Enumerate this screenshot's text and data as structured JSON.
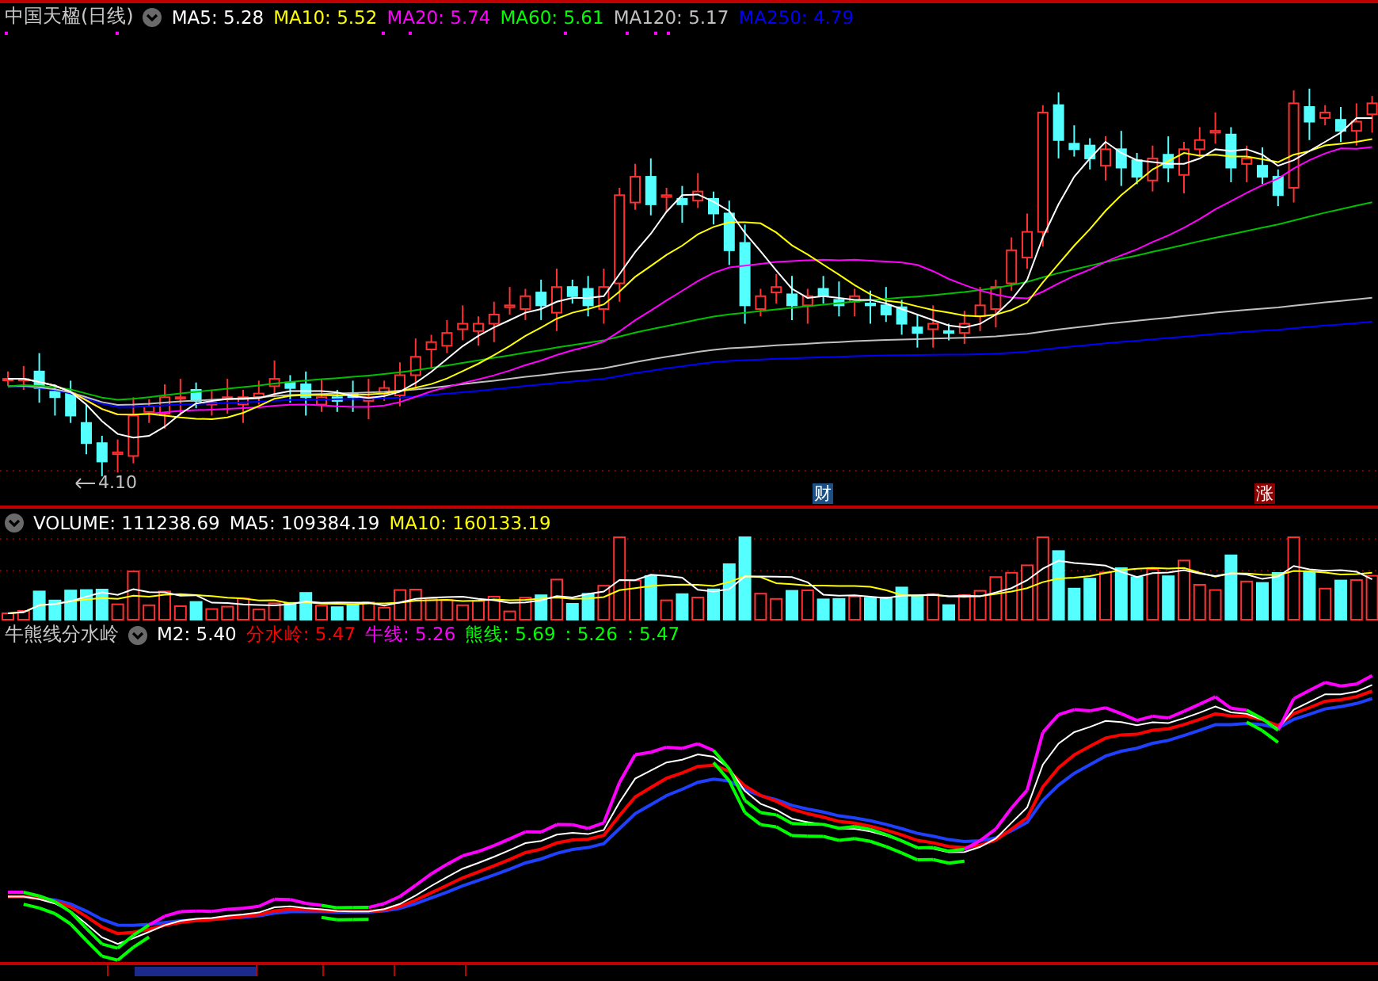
{
  "main_panel": {
    "title": "中国天楹(日线)",
    "indicators": [
      {
        "label": "MA5: 5.28",
        "color": "#ffffff"
      },
      {
        "label": "MA10: 5.52",
        "color": "#ffff00"
      },
      {
        "label": "MA20: 5.74",
        "color": "#ff00ff"
      },
      {
        "label": "MA60: 5.61",
        "color": "#00ff00"
      },
      {
        "label": "MA120: 5.17",
        "color": "#c0c0c0"
      },
      {
        "label": "MA250: 4.79",
        "color": "#0000ff"
      }
    ],
    "low_label": "4.10",
    "markers": [
      {
        "text": "财",
        "color": "#1c4f86"
      },
      {
        "text": "涨",
        "color": "#8c0000"
      }
    ]
  },
  "volume_panel": {
    "indicators": [
      {
        "label": "VOLUME: 111238.69",
        "color": "#ffffff"
      },
      {
        "label": "MA5: 109384.19",
        "color": "#ffffff"
      },
      {
        "label": "MA10: 160133.19",
        "color": "#ffff00"
      }
    ]
  },
  "indicator_panel": {
    "title": "牛熊线分水岭",
    "indicators": [
      {
        "label": "M2: 5.40",
        "color": "#ffffff"
      },
      {
        "label": "分水岭: 5.47",
        "color": "#ff0000"
      },
      {
        "label": "牛线: 5.26",
        "color": "#ff00ff"
      },
      {
        "label": "熊线: 5.69",
        "color": "#00ff00"
      },
      {
        "label": ": 5.26",
        "color": "#00ff00"
      },
      {
        "label": ": 5.47",
        "color": "#00ff00"
      }
    ]
  }
}
